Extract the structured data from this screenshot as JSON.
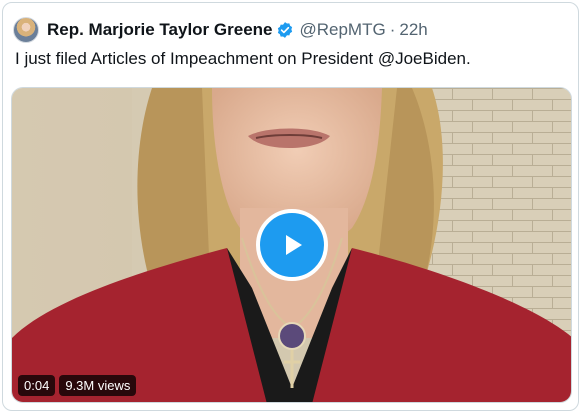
{
  "tweet": {
    "author_name": "Rep. Marjorie Taylor Greene",
    "handle": "@RepMTG",
    "separator": "·",
    "timestamp": "22h",
    "text": "I just filed Articles of Impeachment on President @JoeBiden."
  },
  "video": {
    "duration": "0:04",
    "views": "9.3M views"
  },
  "icons": {
    "verified": "verified-badge-icon",
    "play": "play-icon"
  },
  "colors": {
    "accent": "#1d9bf0",
    "text_primary": "#0f1419",
    "text_secondary": "#536471"
  }
}
